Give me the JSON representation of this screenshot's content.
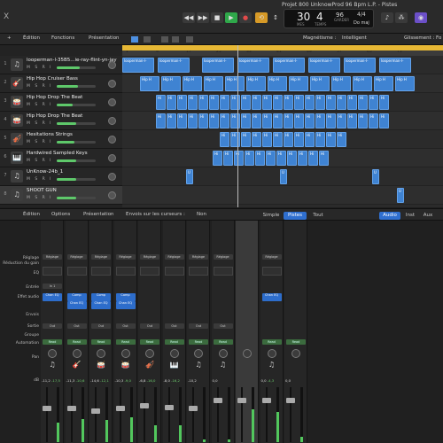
{
  "window": {
    "title": "Projet 800 UnknowProd 96 Bpm L.P. - Pistes"
  },
  "transport": {
    "bars": "30",
    "beats": "4",
    "bars_label": "MES",
    "beats_label": "TEMPS",
    "tempo": "96",
    "tempo_label": "GARDER",
    "signature": "4/4",
    "key": "Do maj"
  },
  "tracks_toolbar": {
    "edit": "Édition",
    "functions": "Fonctions",
    "presentation": "Présentation",
    "snap_label": "Magnétisme :",
    "snap_value": "Intelligent",
    "drag_label": "Glissement :",
    "drag_value": "Fo"
  },
  "tracks": [
    {
      "num": "1",
      "name": "looperman-l-35B5...ie-ray-flint-yn-jay",
      "icon": "♫",
      "vol": 0.6
    },
    {
      "num": "2",
      "name": "Hip Hop Cruiser Bass",
      "icon": "🎸",
      "vol": 0.55
    },
    {
      "num": "3",
      "name": "Hip Hop Drop The Beat",
      "icon": "🥁",
      "vol": 0.4
    },
    {
      "num": "4",
      "name": "Hip Hop Drop The Beat",
      "icon": "🥁",
      "vol": 0.5
    },
    {
      "num": "5",
      "name": "Hesitations Strings",
      "icon": "🎻",
      "vol": 0.45
    },
    {
      "num": "6",
      "name": "Hardwired Sampled Keys",
      "icon": "🎹",
      "vol": 0.5
    },
    {
      "num": "7",
      "name": "UnKnow-24b_1",
      "icon": "♫",
      "vol": 0.5
    },
    {
      "num": "8",
      "name": "SHOOT GUN",
      "icon": "♫",
      "vol": 0.5
    }
  ],
  "msri": "M S R I",
  "ruler": [
    "1",
    "9",
    "17",
    "25",
    "33",
    "41",
    "49",
    "57",
    "65",
    "73"
  ],
  "region_labels": {
    "loop": "looperman-l-",
    "hip": "Hip H",
    "hh": "Hi",
    "u": "U"
  },
  "mixer_toolbar": {
    "edit": "Édition",
    "options": "Options",
    "presentation": "Présentation",
    "sends_label": "Envois sur les curseurs :",
    "sends_value": "Non",
    "simple": "Simple",
    "tracks": "Pistes",
    "all": "Tout",
    "audio": "Audio",
    "inst": "Inst",
    "aux": "Aux"
  },
  "mixer_rows": {
    "setting": "Réglage",
    "gain": "Réduction du gain",
    "eq": "EQ",
    "input": "Entrée",
    "fx": "Effet audio",
    "sends": "Envois",
    "output": "Sortie",
    "group": "Groupe",
    "automation": "Automation",
    "pan": "Pan",
    "db": "dB"
  },
  "strips": [
    {
      "setting": "Réglage",
      "input": "In 1",
      "fx": [
        "Chan EQ"
      ],
      "out": "Out",
      "auto": "Read",
      "db": "-11,2",
      "peak": "-17,5",
      "fader": 0.62,
      "meter": 0.35,
      "icon": "♫"
    },
    {
      "setting": "Réglage",
      "input": "",
      "fx": [
        "Comp",
        "Chan EQ"
      ],
      "out": "Out",
      "auto": "Read",
      "db": "-11,3",
      "peak": "-10,6",
      "fader": 0.62,
      "meter": 0.42,
      "icon": "🎸"
    },
    {
      "setting": "Réglage",
      "input": "",
      "fx": [
        "Comp",
        "Chan EQ"
      ],
      "out": "Out",
      "auto": "Read",
      "db": "-14,6",
      "peak": "-12,1",
      "fader": 0.58,
      "meter": 0.4,
      "icon": "🥁"
    },
    {
      "setting": "Réglage",
      "input": "",
      "fx": [
        "Comp",
        "Chan EQ"
      ],
      "out": "Out",
      "auto": "Read",
      "db": "-10,3",
      "peak": "-9,0",
      "fader": 0.63,
      "meter": 0.45,
      "icon": "🥁"
    },
    {
      "setting": "Réglage",
      "input": "",
      "fx": [],
      "out": "Out",
      "auto": "Read",
      "db": "-6,8",
      "peak": "-16,0",
      "fader": 0.67,
      "meter": 0.3,
      "icon": "🎻"
    },
    {
      "setting": "Réglage",
      "input": "",
      "fx": [],
      "out": "Out",
      "auto": "Read",
      "db": "-8,0",
      "peak": "-16,2",
      "fader": 0.65,
      "meter": 0.3,
      "icon": "🎹"
    },
    {
      "setting": "Réglage",
      "input": "",
      "fx": [],
      "out": "Out",
      "auto": "Read",
      "db": "-10,2",
      "peak": "",
      "fader": 0.62,
      "meter": 0.05,
      "icon": "♫"
    },
    {
      "setting": "Réglage",
      "input": "",
      "fx": [],
      "out": "Out",
      "auto": "Read",
      "db": "0,0",
      "peak": "",
      "fader": 0.78,
      "meter": 0.05,
      "icon": "♫"
    },
    {
      "setting": "",
      "input": "",
      "fx": [],
      "out": "",
      "auto": "",
      "db": "",
      "peak": "",
      "fader": 0.78,
      "meter": 0.6,
      "icon": ""
    },
    {
      "setting": "Réglage",
      "input": "",
      "fx": [
        "Chan EQ"
      ],
      "out": "",
      "auto": "Read",
      "db": "0,0",
      "peak": "-4,3",
      "fader": 0.78,
      "meter": 0.55,
      "icon": "♫"
    },
    {
      "setting": "",
      "input": "",
      "fx": [],
      "out": "",
      "auto": "Read",
      "db": "0,0",
      "peak": "",
      "fader": 0.78,
      "meter": 0.1,
      "icon": ""
    }
  ]
}
